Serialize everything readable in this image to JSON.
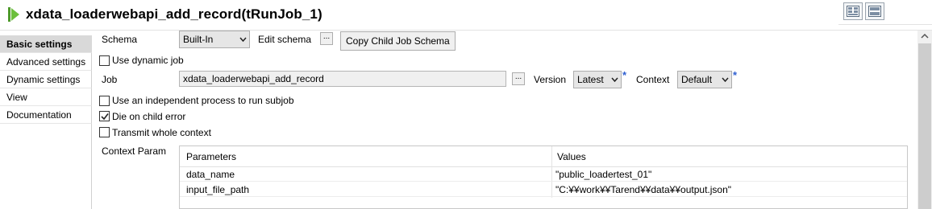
{
  "window": {
    "title": "xdata_loaderwebapi_add_record(tRunJob_1)",
    "accent_color": "#5ba830"
  },
  "tabs": [
    {
      "label": "Basic settings",
      "active": true
    },
    {
      "label": "Advanced settings",
      "active": false
    },
    {
      "label": "Dynamic settings",
      "active": false
    },
    {
      "label": "View",
      "active": false
    },
    {
      "label": "Documentation",
      "active": false
    }
  ],
  "schema": {
    "label": "Schema",
    "value": "Built-In",
    "edit_label": "Edit schema",
    "edit_button": "...",
    "copy_button": "Copy Child Job Schema"
  },
  "use_dynamic_job": {
    "label": "Use dynamic job",
    "checked": false
  },
  "job": {
    "label": "Job",
    "value": "xdata_loaderwebapi_add_record",
    "browse_button": "...",
    "version_label": "Version",
    "version_value": "Latest",
    "context_label": "Context",
    "context_value": "Default",
    "required_mark": "*"
  },
  "options": [
    {
      "label": "Use an independent process to run subjob",
      "checked": false
    },
    {
      "label": "Die on child error",
      "checked": true
    },
    {
      "label": "Transmit whole context",
      "checked": false
    }
  ],
  "context_param": {
    "label": "Context Param",
    "headers": [
      "Parameters",
      "Values"
    ],
    "rows": [
      {
        "parameter": "data_name",
        "value": "\"public_loadertest_01\""
      },
      {
        "parameter": "input_file_path",
        "value": "\"C:¥¥work¥¥Tarend¥¥data¥¥output.json\""
      }
    ]
  },
  "icons": {
    "run": "play-icon",
    "layout_a": "grid-layout-icon",
    "layout_b": "rows-layout-icon",
    "dropdown": "chevron-down-icon",
    "check": "checkmark-icon",
    "scroll_up": "chevron-up-icon"
  }
}
